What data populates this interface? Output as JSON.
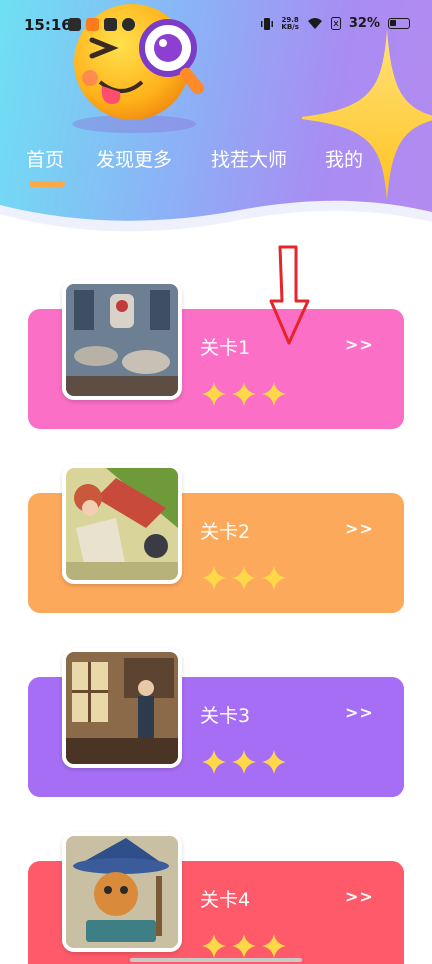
{
  "status_bar": {
    "time": "15:16",
    "net_speed_value": "29.8",
    "net_speed_unit": "KB/s",
    "battery": "32%"
  },
  "nav": {
    "tabs": [
      {
        "label": "首页",
        "active": true
      },
      {
        "label": "发现更多",
        "active": false
      },
      {
        "label": "找茬大师",
        "active": false
      },
      {
        "label": "我的",
        "active": false
      }
    ]
  },
  "levels": [
    {
      "name": "关卡1",
      "arrow": ">>",
      "stars": 3,
      "color": "#fb6fc7",
      "thumb": "sci-fi-lab-robot"
    },
    {
      "name": "关卡2",
      "arrow": ">>",
      "stars": 3,
      "color": "#fda95c",
      "thumb": "picnic-girl-cat"
    },
    {
      "name": "关卡3",
      "arrow": ">>",
      "stars": 3,
      "color": "#a66ef5",
      "thumb": "study-room-gentleman"
    },
    {
      "name": "关卡4",
      "arrow": ">>",
      "stars": 3,
      "color": "#ff5a6a",
      "thumb": "wizard-cat"
    }
  ],
  "colors": {
    "header_start": "#6fe0f3",
    "header_end": "#b48bf0",
    "tab_indicator": "#f9a94a",
    "star": "#ffd84a",
    "annotation_arrow": "#e5252a"
  }
}
